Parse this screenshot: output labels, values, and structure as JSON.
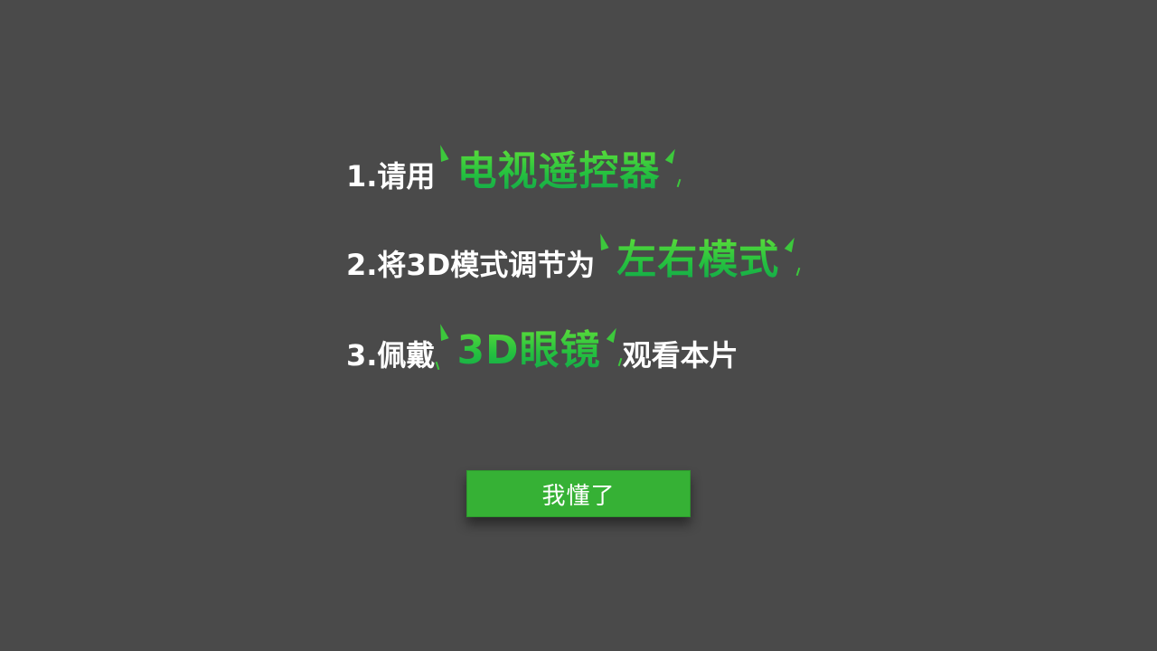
{
  "instructions": {
    "step1": {
      "prefix": "1.请用",
      "highlight": "电视遥控器"
    },
    "step2": {
      "prefix": "2.将3D模式调节为",
      "highlight": "左右模式"
    },
    "step3": {
      "prefix": "3.佩戴",
      "highlight": "3D眼镜",
      "suffix": "观看本片"
    }
  },
  "button": {
    "label": "我懂了"
  },
  "colors": {
    "background": "#4a4a4a",
    "accent_green": "#36b135",
    "highlight_green": "#25c13f",
    "text_white": "#ffffff"
  },
  "icons": {
    "sparkle": "sparkle-accent-icon"
  }
}
